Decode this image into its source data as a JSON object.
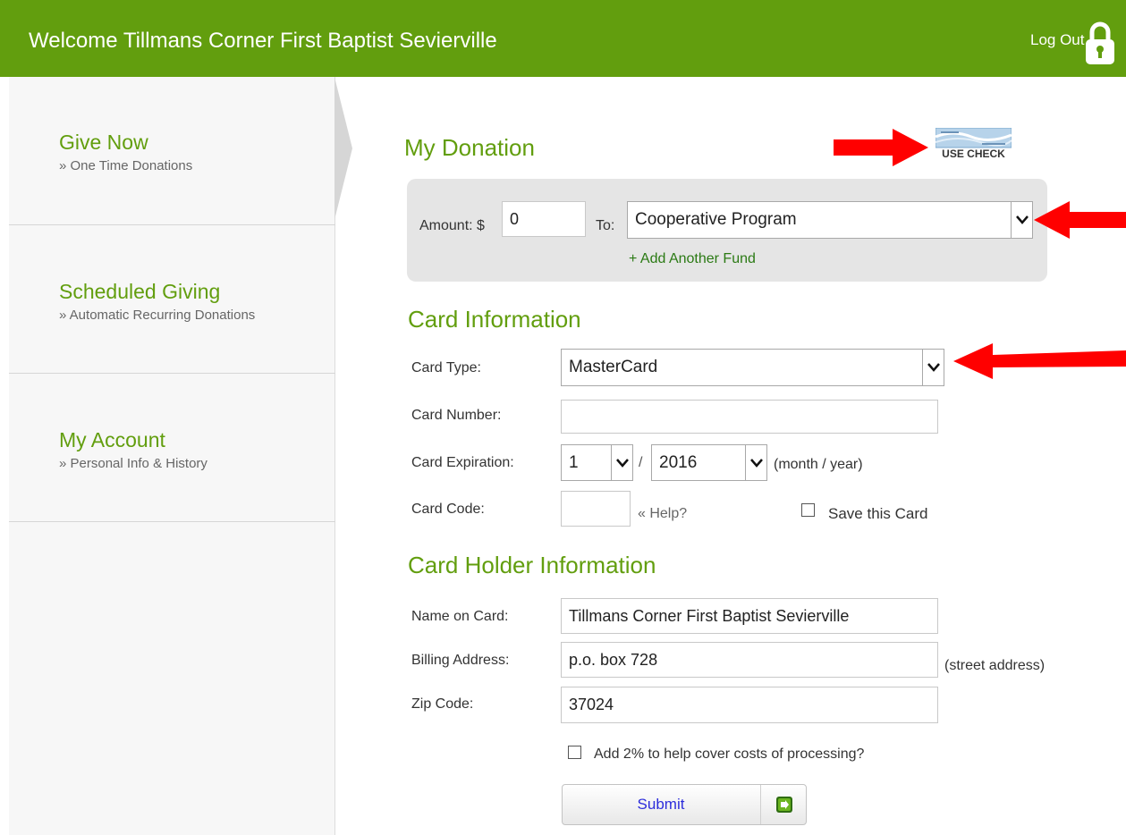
{
  "header": {
    "title": "Welcome Tillmans Corner First Baptist Sevierville",
    "logout_label": "Log Out",
    "lock_icon": "lock-icon",
    "bg_color": "#629e0e"
  },
  "sidebar": {
    "items": [
      {
        "title": "Give Now",
        "subtitle": "» One Time Donations"
      },
      {
        "title": "Scheduled Giving",
        "subtitle": "» Automatic Recurring Donations"
      },
      {
        "title": "My Account",
        "subtitle": "» Personal Info & History"
      }
    ],
    "active_index": 0
  },
  "donation": {
    "title": "My Donation",
    "use_check_label": "USE CHECK",
    "amount_label": "Amount: $",
    "amount_value": "0",
    "to_label": "To:",
    "fund_selected": "Cooperative Program",
    "add_fund_label": "+ Add Another Fund"
  },
  "card": {
    "title": "Card Information",
    "type_label": "Card Type:",
    "type_selected": "MasterCard",
    "number_label": "Card Number:",
    "number_value": "",
    "expiration_label": "Card Expiration:",
    "exp_month": "1",
    "exp_sep": "/",
    "exp_year": "2016",
    "exp_hint": "(month / year)",
    "code_label": "Card Code:",
    "code_value": "",
    "help_label": "« Help?",
    "save_label": "Save this Card"
  },
  "holder": {
    "title": "Card Holder Information",
    "name_label": "Name on Card:",
    "name_value": "Tillmans Corner First Baptist Sevierville",
    "address_label": "Billing Address:",
    "address_value": "p.o. box 728",
    "address_hint": "(street address)",
    "zip_label": "Zip Code:",
    "zip_value": "37024",
    "cover_label": "Add 2% to help cover costs of processing?"
  },
  "submit": {
    "label": "Submit"
  },
  "annotation": {
    "arrow_color": "#ff0000"
  }
}
